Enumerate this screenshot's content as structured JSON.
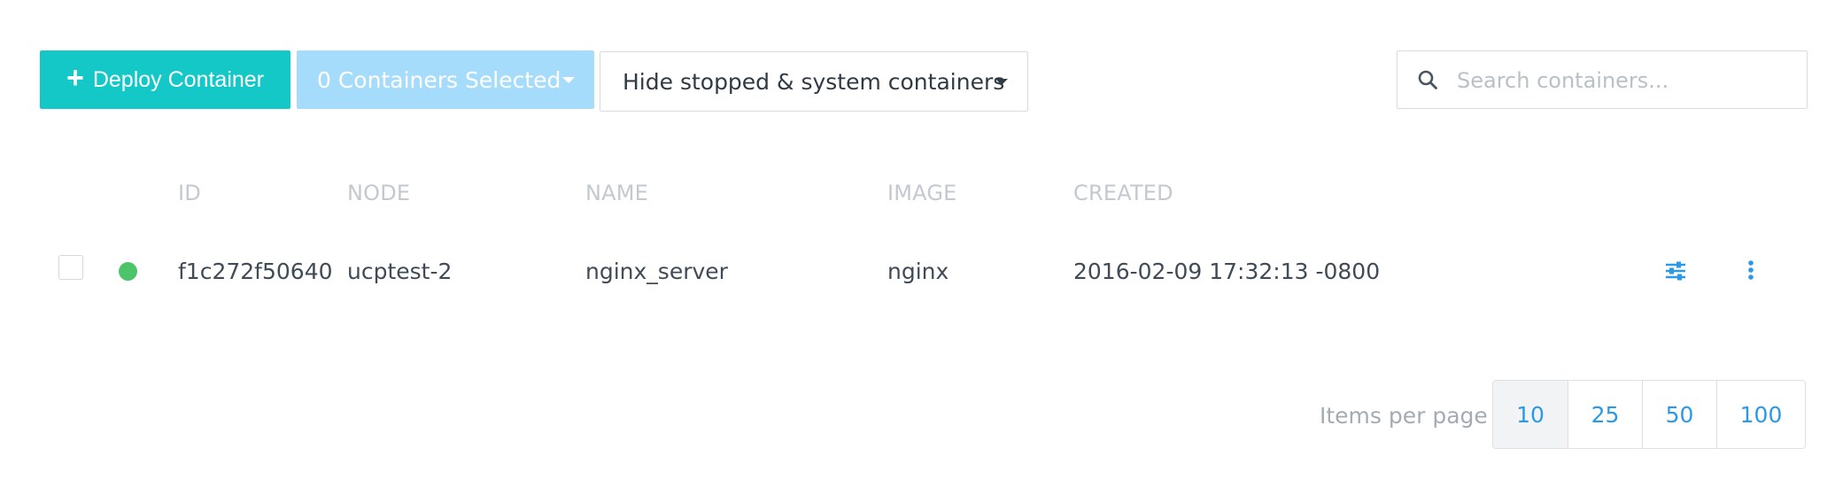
{
  "toolbar": {
    "deploy_label": "Deploy Container",
    "selected_label": "0 Containers Selected",
    "filter_label": "Hide stopped & system containers",
    "search_placeholder": "Search containers..."
  },
  "table": {
    "columns": [
      "ID",
      "NODE",
      "NAME",
      "IMAGE",
      "CREATED"
    ],
    "rows": [
      {
        "status": "running",
        "id": "f1c272f50640",
        "node": "ucptest-2",
        "name": "nginx_server",
        "image": "nginx",
        "created": "2016-02-09 17:32:13 -0800"
      }
    ]
  },
  "pagination": {
    "label": "Items per page",
    "options": [
      "10",
      "25",
      "50",
      "100"
    ],
    "selected": "10"
  },
  "colors": {
    "accent": "#14c8c8",
    "selected_button": "#a6dcfb",
    "link": "#2a9ae8",
    "status_running": "#4cc46a"
  },
  "icons": {
    "deploy": "plus-icon",
    "dropdown": "caret-down-icon",
    "search": "search-icon",
    "row_settings": "sliders-icon",
    "row_menu": "vertical-dots-icon"
  }
}
